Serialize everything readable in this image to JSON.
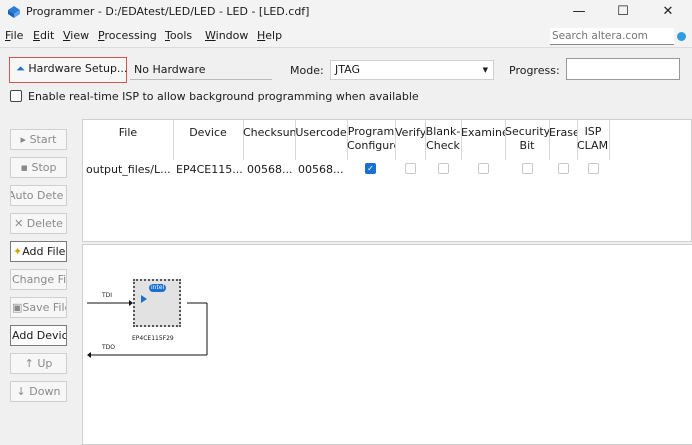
{
  "window": {
    "title": "Programmer - D:/EDAtest/LED/LED - LED - [LED.cdf]",
    "minimize": "—",
    "maximize": "☐",
    "close": "✕"
  },
  "menu": {
    "items": [
      {
        "label": "File",
        "u": "F",
        "rest": "ile"
      },
      {
        "label": "Edit",
        "u": "E",
        "rest": "dit"
      },
      {
        "label": "View",
        "u": "V",
        "rest": "iew"
      },
      {
        "label": "Processing",
        "u": "P",
        "rest": "rocessing"
      },
      {
        "label": "Tools",
        "u": "T",
        "rest": "ools"
      },
      {
        "label": "Window",
        "u": "W",
        "rest": "indow"
      },
      {
        "label": "Help",
        "u": "H",
        "rest": "elp"
      }
    ],
    "search_placeholder": "Search altera.com"
  },
  "toolbar": {
    "hardware_setup": "Hardware Setup...",
    "hardware_value": "No Hardware",
    "mode_label": "Mode:",
    "mode_value": "JTAG",
    "progress_label": "Progress:"
  },
  "isp": {
    "label": "Enable real-time ISP to allow background programming when available",
    "checked": false
  },
  "sidebar": {
    "start": "Start",
    "stop": "Stop",
    "auto_detect": "Auto Dete",
    "delete": "Delete",
    "add_file": "Add File.",
    "change_file": "Change Fil",
    "save_file": "Save File",
    "add_device": "Add Devic",
    "up": "Up",
    "down": "Down"
  },
  "table": {
    "headers": {
      "file": "File",
      "device": "Device",
      "checksum": "Checksun",
      "usercode": "Usercode",
      "program_1": "Program",
      "program_2": "Configure",
      "verify": "Verify",
      "blank_1": "Blank-",
      "blank_2": "Check",
      "examine": "Examine",
      "security_1": "Security",
      "security_2": "Bit",
      "erase": "Erase",
      "isp_1": "ISP",
      "isp_2": "CLAMP"
    },
    "row": {
      "file": "output_files/L...",
      "device": "EP4CE115...",
      "checksum": "00568...",
      "usercode": "00568...",
      "program": true,
      "verify": false,
      "blank_check": false,
      "examine": false,
      "security_bit": false,
      "erase": false,
      "isp_clamp": false
    }
  },
  "diagram": {
    "tdi": "TDI",
    "tdo": "TDO",
    "chip_brand": "intel",
    "chip_name": "EP4CE115F29"
  },
  "colors": {
    "accent": "#1a6fd1",
    "highlight_border": "#d9534f"
  }
}
